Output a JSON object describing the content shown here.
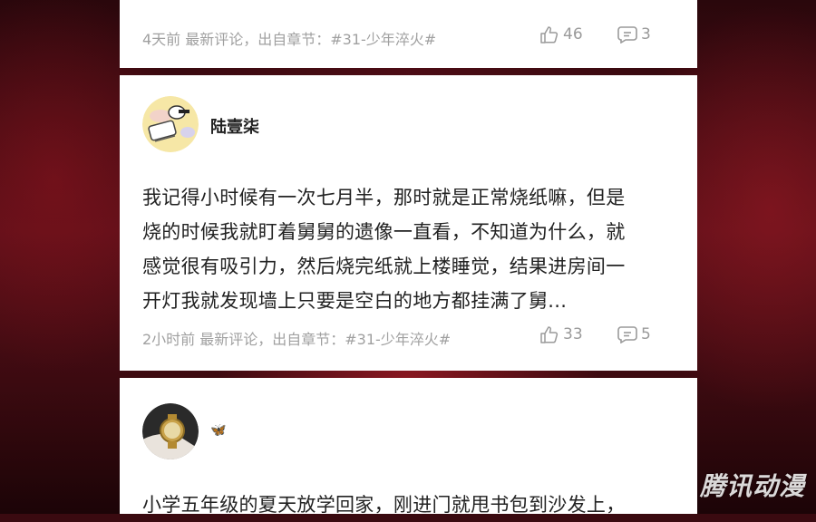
{
  "comments": [
    {
      "meta": "4天前 最新评论，出自章节：#31-少年淬火#",
      "likes": "46",
      "replies": "3"
    },
    {
      "username": "陆壹柒",
      "text_lines": [
        "我记得小时候有一次七月半，那时就是正常烧纸嘛，但是",
        "烧的时候我就盯着舅舅的遗像一直看，不知道为什么，就",
        "感觉很有吸引力，然后烧完纸就上楼睡觉，结果进房间一",
        "开灯我就发现墙上只要是空白的地方都挂满了舅..."
      ],
      "meta": "2小时前 最新评论，出自章节：#31-少年淬火#",
      "likes": "33",
      "replies": "5"
    },
    {
      "username": "🦋",
      "text_lines": [
        "小学五年级的夏天放学回家，刚进门就甩书包到沙发上，"
      ]
    }
  ],
  "watermark": "腾讯动漫",
  "colors": {
    "card_bg": "#ffffff",
    "meta_text": "#a0a0a0",
    "background": "#5a0f18"
  },
  "icons": [
    "thumbs-up-icon",
    "comment-icon"
  ]
}
